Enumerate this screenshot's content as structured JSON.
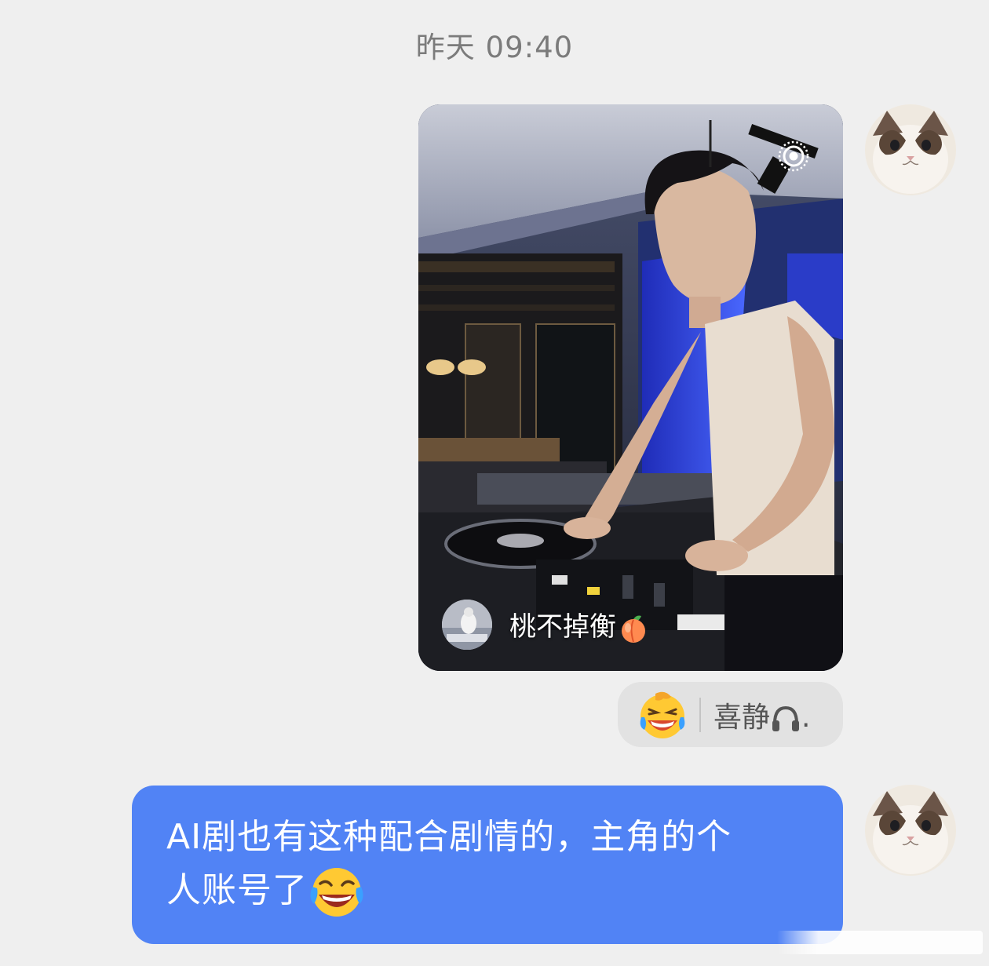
{
  "chat": {
    "timestamp": "昨天 09:40",
    "photo_message": {
      "author_name": "桃不掉衡",
      "author_emoji": "peach",
      "live_icon": "live-photo-icon"
    },
    "reaction": {
      "emoji": "laughing-crying-emoji",
      "user_name": "喜静",
      "user_name_suffix_icon": "headphone-icon",
      "user_name_end": "."
    },
    "text_message": {
      "line1": "AI剧也有这种配合剧情的，主角的个",
      "line2": "人账号了",
      "trailing_emoji": "laughing-tears-emoji"
    }
  },
  "colors": {
    "background": "#efefef",
    "bubble": "#5183f5",
    "reaction_pill": "#e2e2e2",
    "timestamp_text": "#7b7b7b"
  }
}
